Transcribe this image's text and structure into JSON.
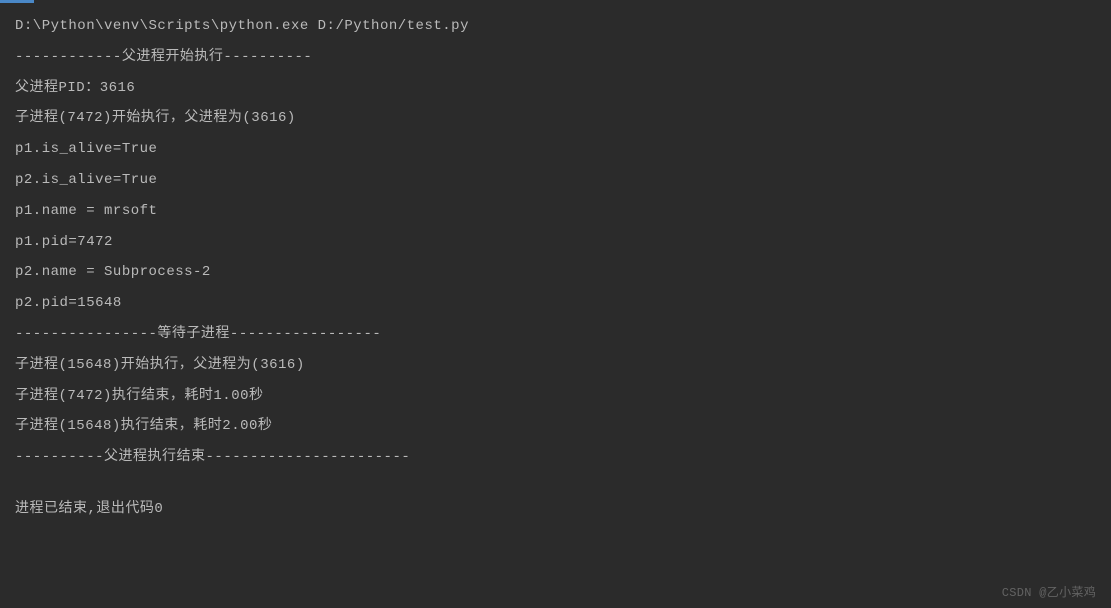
{
  "console": {
    "lines": [
      "D:\\Python\\venv\\Scripts\\python.exe D:/Python/test.py",
      "------------父进程开始执行----------",
      "父进程PID：3616",
      "子进程(7472)开始执行，父进程为(3616)",
      "p1.is_alive=True",
      "p2.is_alive=True",
      "p1.name = mrsoft",
      "p1.pid=7472",
      "p2.name = Subprocess-2",
      "p2.pid=15648",
      "----------------等待子进程-----------------",
      "子进程(15648)开始执行，父进程为(3616)",
      "子进程(7472)执行结束，耗时1.00秒",
      "子进程(15648)执行结束，耗时2.00秒",
      "----------父进程执行结束-----------------------",
      "",
      "进程已结束,退出代码0"
    ]
  },
  "watermark": "CSDN @乙小菜鸡"
}
